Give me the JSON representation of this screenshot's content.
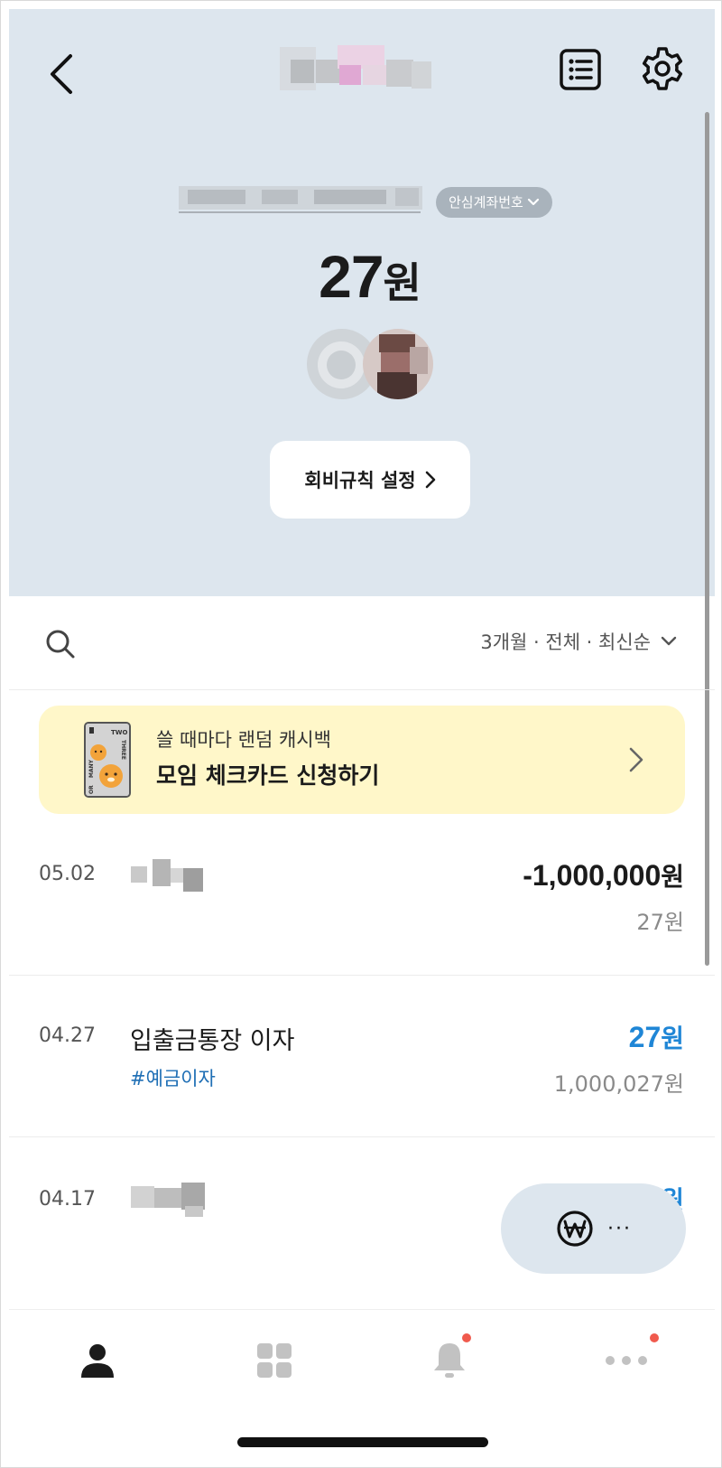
{
  "header": {
    "title": "",
    "account_number": "",
    "safe_account_label": "안심계좌번호",
    "balance_value": "27",
    "balance_unit": "원"
  },
  "actions": {
    "fee_rule_label": "회비규칙 설정"
  },
  "filter": {
    "label": "3개월 · 전체 · 최신순"
  },
  "promo": {
    "subtitle": "쓸 때마다 랜덤 캐시백",
    "title": "모임 체크카드 신청하기",
    "card_text": [
      "TWO",
      "THREE",
      "OR",
      "MANY"
    ]
  },
  "transactions": [
    {
      "date": "05.02",
      "title": "",
      "tag": "",
      "amount": "-1,000,000",
      "unit": "원",
      "balance": "27원",
      "type": "withdrawal"
    },
    {
      "date": "04.27",
      "title": "입출금통장 이자",
      "tag": "#예금이자",
      "amount": "27",
      "unit": "원",
      "balance": "1,000,027원",
      "type": "deposit"
    },
    {
      "date": "04.17",
      "title": "",
      "tag": "",
      "amount": "1",
      "unit": "원",
      "balance": "",
      "type": "deposit"
    }
  ],
  "fab": {
    "icon": "won-icon",
    "more_label": "···"
  },
  "nav": {
    "items": [
      {
        "icon": "person-icon",
        "active": true,
        "badge": false
      },
      {
        "icon": "grid-icon",
        "active": false,
        "badge": false
      },
      {
        "icon": "bell-icon",
        "active": false,
        "badge": true
      },
      {
        "icon": "more-dots-icon",
        "active": false,
        "badge": true
      }
    ]
  },
  "colors": {
    "hero_bg": "#dde6ee",
    "deposit_blue": "#1f86d6",
    "tag_blue": "#1f6fb5",
    "promo_bg": "#fff7c9",
    "badge_red": "#f05a4d"
  }
}
